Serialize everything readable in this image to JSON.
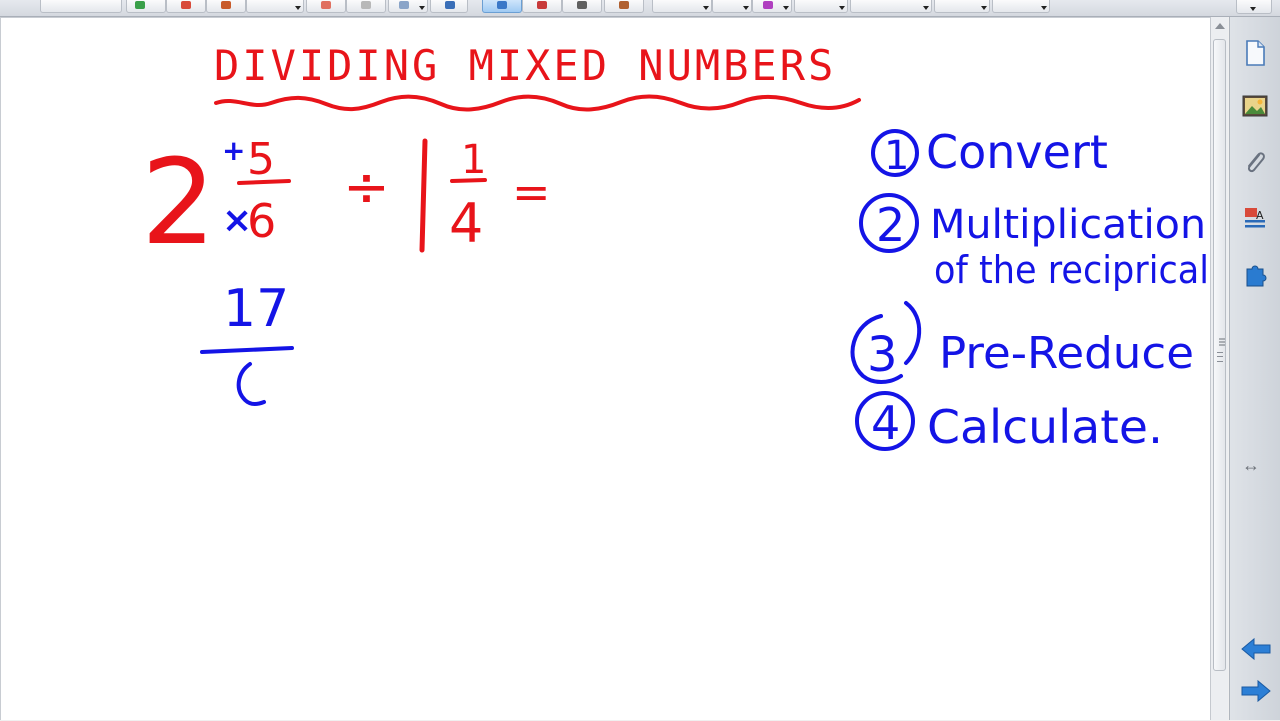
{
  "lesson": {
    "title": "DIVIDING MIXED NUMBERS",
    "problem": {
      "whole1": "2",
      "plus_mark": "+",
      "times_mark": "×",
      "numerator1": "5",
      "denominator1": "6",
      "divide_sign": "÷",
      "whole2": "1",
      "numerator2": "1",
      "denominator2": "4",
      "equals": "="
    },
    "work": {
      "numerator": "17",
      "denominator_partial": "("
    },
    "steps": [
      {
        "number": "1",
        "text": "Convert"
      },
      {
        "number": "2",
        "text": "Multiplication",
        "text2": "of the reciprical"
      },
      {
        "number": "3",
        "text": "Pre-Reduce"
      },
      {
        "number": "4",
        "text": "Calculate."
      }
    ]
  },
  "colors": {
    "title_red": "#e8141a",
    "ink_red": "#e8141a",
    "ink_blue": "#1414e6",
    "canvas": "#ffffff"
  },
  "side_tabs": [
    "page-sorter-icon",
    "gallery-icon",
    "attachments-icon",
    "properties-icon",
    "addons-icon"
  ]
}
